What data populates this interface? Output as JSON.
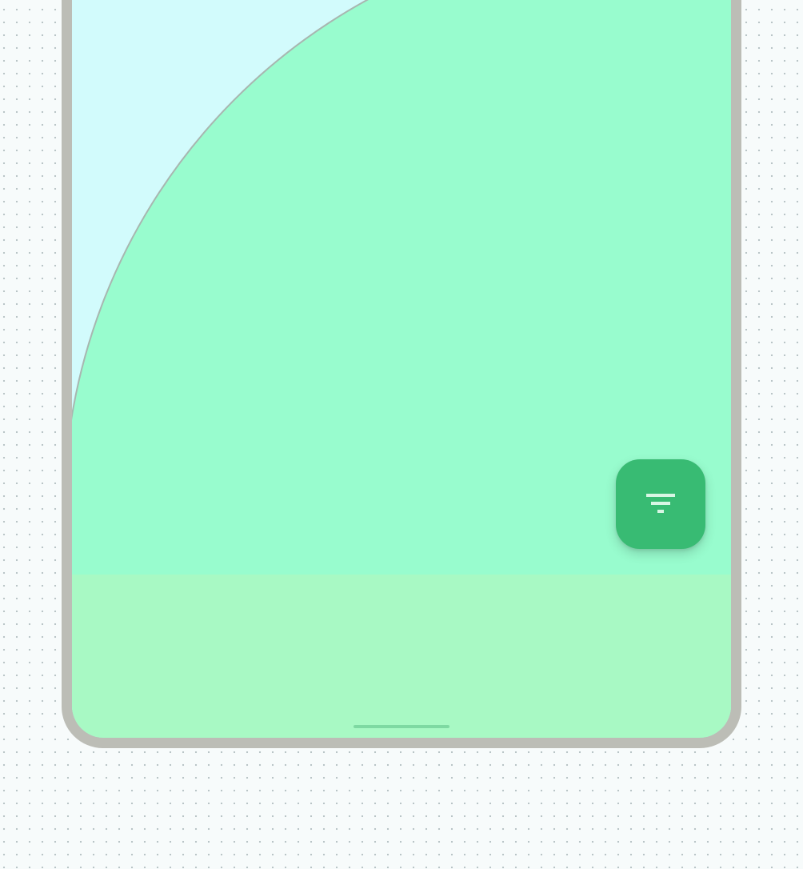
{
  "theme": {
    "page_background": "#f7fbfb",
    "device_frame": "#bcbdb6",
    "screen_background": "#d2fbfc",
    "arc_fill": "#98fcce",
    "arc_stroke": "#a8b6b0",
    "bottom_bar": "#a8f9c4",
    "gesture_handle": "#7ed9a2",
    "fab_background": "#38bb73",
    "fab_icon": "#d8f6e4"
  },
  "fab": {
    "icon": "filter-icon"
  }
}
